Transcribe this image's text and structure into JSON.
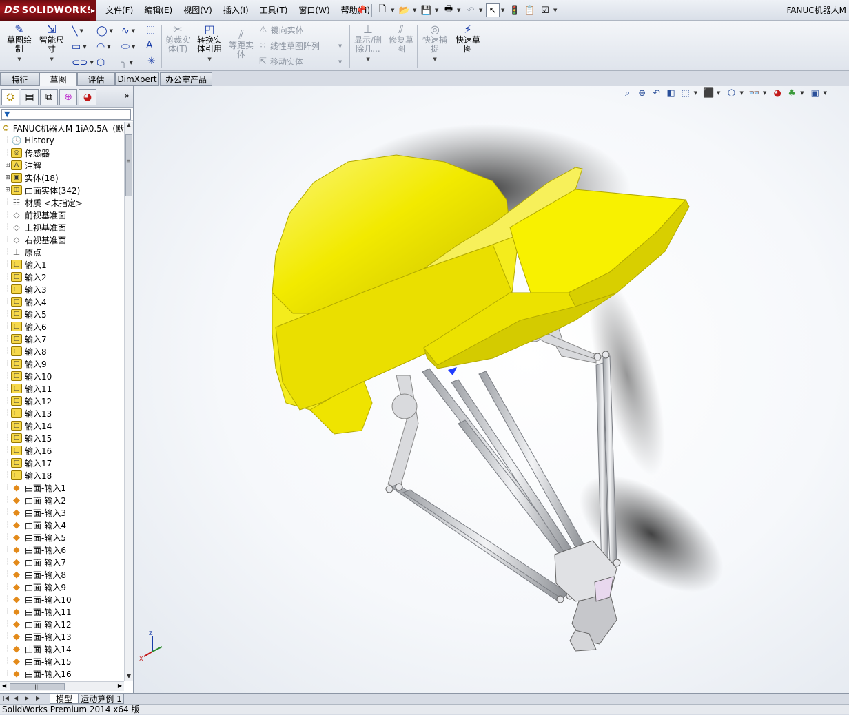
{
  "app": {
    "logo_text": "SOLIDWORKS",
    "logo_ds": "DS",
    "window_title": "FANUC机器人M"
  },
  "menu": [
    "文件(F)",
    "编辑(E)",
    "视图(V)",
    "插入(I)",
    "工具(T)",
    "窗口(W)",
    "帮助(H)"
  ],
  "command_manager": {
    "sketch": "草图绘\n制",
    "smart_dim": "智能尺\n寸",
    "trim": "剪裁实\n体(T)",
    "convert": "转换实\n体引用",
    "offset": "等距实\n体",
    "mirror": "镜向实体",
    "linear_pattern": "线性草图阵列",
    "move": "移动实体",
    "display_delete": "显示/删\n除几...",
    "repair": "修复草\n图",
    "quick_snap": "快速捕\n捉",
    "rapid_sketch": "快速草\n图"
  },
  "tabs": [
    "特征",
    "草图",
    "评估",
    "DimXpert",
    "办公室产品"
  ],
  "active_tab": "草图",
  "tree": {
    "root": "FANUC机器人M-1iA0.5A（默",
    "items": [
      {
        "label": "History",
        "icon": "history-icon",
        "exp": ""
      },
      {
        "label": "传感器",
        "icon": "sensor-icon",
        "exp": ""
      },
      {
        "label": "注解",
        "icon": "annotation-icon",
        "exp": "+"
      },
      {
        "label": "实体(18)",
        "icon": "solid-bodies-icon",
        "exp": "+"
      },
      {
        "label": "曲面实体(342)",
        "icon": "surface-bodies-icon",
        "exp": "+"
      },
      {
        "label": "材质 <未指定>",
        "icon": "material-icon",
        "exp": ""
      },
      {
        "label": "前视基准面",
        "icon": "plane-icon",
        "exp": ""
      },
      {
        "label": "上视基准面",
        "icon": "plane-icon",
        "exp": ""
      },
      {
        "label": "右视基准面",
        "icon": "plane-icon",
        "exp": ""
      },
      {
        "label": "原点",
        "icon": "origin-icon",
        "exp": ""
      },
      {
        "label": "输入1",
        "icon": "import-icon",
        "exp": ""
      },
      {
        "label": "输入2",
        "icon": "import-icon",
        "exp": ""
      },
      {
        "label": "输入3",
        "icon": "import-icon",
        "exp": ""
      },
      {
        "label": "输入4",
        "icon": "import-icon",
        "exp": ""
      },
      {
        "label": "输入5",
        "icon": "import-icon",
        "exp": ""
      },
      {
        "label": "输入6",
        "icon": "import-icon",
        "exp": ""
      },
      {
        "label": "输入7",
        "icon": "import-icon",
        "exp": ""
      },
      {
        "label": "输入8",
        "icon": "import-icon",
        "exp": ""
      },
      {
        "label": "输入9",
        "icon": "import-icon",
        "exp": ""
      },
      {
        "label": "输入10",
        "icon": "import-icon",
        "exp": ""
      },
      {
        "label": "输入11",
        "icon": "import-icon",
        "exp": ""
      },
      {
        "label": "输入12",
        "icon": "import-icon",
        "exp": ""
      },
      {
        "label": "输入13",
        "icon": "import-icon",
        "exp": ""
      },
      {
        "label": "输入14",
        "icon": "import-icon",
        "exp": ""
      },
      {
        "label": "输入15",
        "icon": "import-icon",
        "exp": ""
      },
      {
        "label": "输入16",
        "icon": "import-icon",
        "exp": ""
      },
      {
        "label": "输入17",
        "icon": "import-icon",
        "exp": ""
      },
      {
        "label": "输入18",
        "icon": "import-icon",
        "exp": ""
      },
      {
        "label": "曲面-输入1",
        "icon": "surface-import-icon",
        "exp": ""
      },
      {
        "label": "曲面-输入2",
        "icon": "surface-import-icon",
        "exp": ""
      },
      {
        "label": "曲面-输入3",
        "icon": "surface-import-icon",
        "exp": ""
      },
      {
        "label": "曲面-输入4",
        "icon": "surface-import-icon",
        "exp": ""
      },
      {
        "label": "曲面-输入5",
        "icon": "surface-import-icon",
        "exp": ""
      },
      {
        "label": "曲面-输入6",
        "icon": "surface-import-icon",
        "exp": ""
      },
      {
        "label": "曲面-输入7",
        "icon": "surface-import-icon",
        "exp": ""
      },
      {
        "label": "曲面-输入8",
        "icon": "surface-import-icon",
        "exp": ""
      },
      {
        "label": "曲面-输入9",
        "icon": "surface-import-icon",
        "exp": ""
      },
      {
        "label": "曲面-输入10",
        "icon": "surface-import-icon",
        "exp": ""
      },
      {
        "label": "曲面-输入11",
        "icon": "surface-import-icon",
        "exp": ""
      },
      {
        "label": "曲面-输入12",
        "icon": "surface-import-icon",
        "exp": ""
      },
      {
        "label": "曲面-输入13",
        "icon": "surface-import-icon",
        "exp": ""
      },
      {
        "label": "曲面-输入14",
        "icon": "surface-import-icon",
        "exp": ""
      },
      {
        "label": "曲面-输入15",
        "icon": "surface-import-icon",
        "exp": ""
      },
      {
        "label": "曲面-输入16",
        "icon": "surface-import-icon",
        "exp": ""
      }
    ]
  },
  "bottom_tabs": [
    "模型",
    "运动算例 1"
  ],
  "active_bottom_tab": "模型",
  "status": "SolidWorks Premium 2014 x64 版",
  "triad": {
    "z": "Z",
    "x": "X"
  },
  "colors": {
    "model_yellow": "#f2ea00",
    "logo_red": "#a8161d",
    "link_gray": "#d9dadd"
  }
}
